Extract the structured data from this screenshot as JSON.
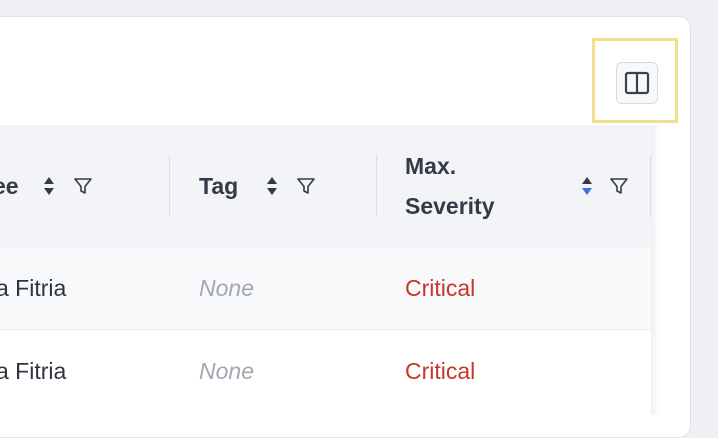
{
  "toolbar": {
    "column_toggle_icon": "columns-icon",
    "highlight_color": "#f3de8a"
  },
  "table": {
    "columns": [
      {
        "label": "ee",
        "sort": "none"
      },
      {
        "label": "Tag",
        "sort": "none"
      },
      {
        "label": "Max.\nSeverity",
        "label_line1": "Max.",
        "label_line2": "Severity",
        "sort": "descending"
      }
    ],
    "rows": [
      {
        "person": "a Fitria",
        "tag": "None",
        "severity": "Critical"
      },
      {
        "person": "a Fitria",
        "tag": "None",
        "severity": "Critical"
      }
    ]
  },
  "colors": {
    "severity_critical": "#c7352b",
    "sort_active": "#3f6fd8"
  }
}
